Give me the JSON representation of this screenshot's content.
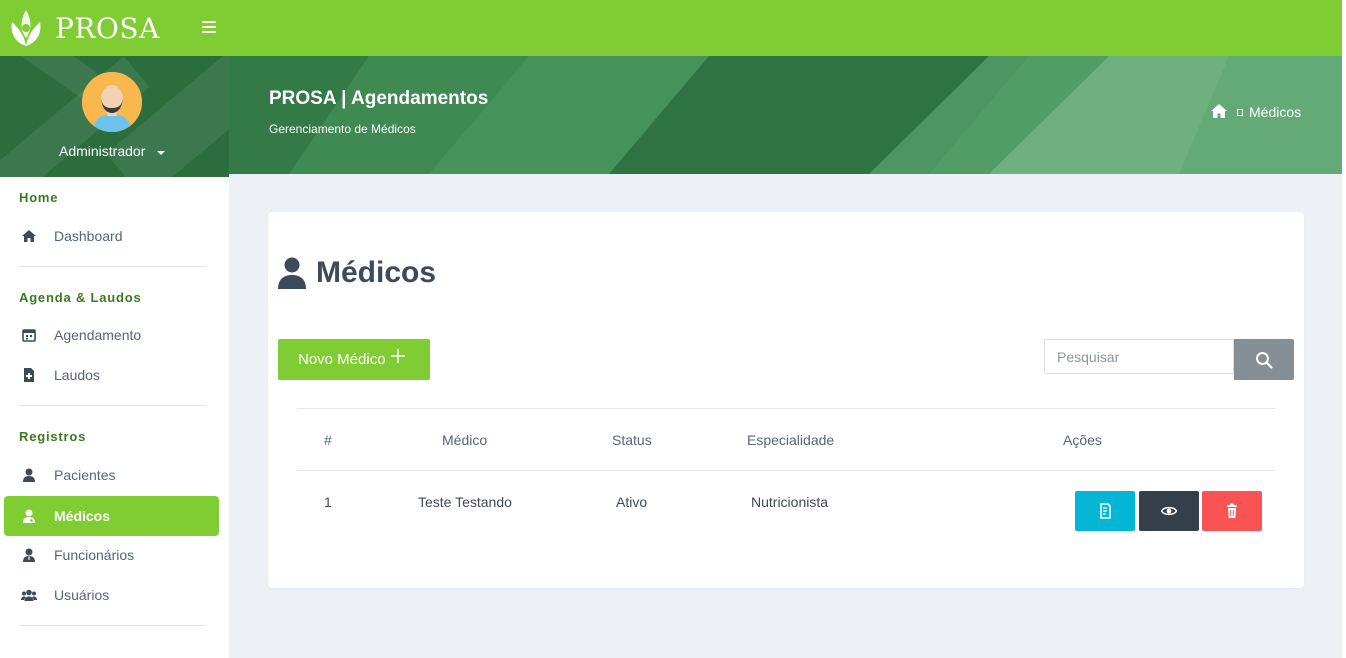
{
  "app": {
    "logo_text": "PROSA"
  },
  "colors": {
    "brand": "#7fcc33",
    "banner": "#3f8a52",
    "info": "#03b6d6",
    "dark": "#343f4a",
    "danger": "#fa5353"
  },
  "user": {
    "name": "Administrador",
    "icon": "avatar-icon"
  },
  "sidebar": {
    "sections": [
      {
        "caption": "Home",
        "items": [
          {
            "label": "Dashboard",
            "icon": "home-icon"
          }
        ]
      },
      {
        "caption": "Agenda & Laudos",
        "items": [
          {
            "label": "Agendamento",
            "icon": "calendar-icon"
          },
          {
            "label": "Laudos",
            "icon": "medical-file-icon"
          }
        ]
      },
      {
        "caption": "Registros",
        "items": [
          {
            "label": "Pacientes",
            "icon": "user-icon"
          },
          {
            "label": "Médicos",
            "icon": "doctor-icon",
            "active": true
          },
          {
            "label": "Funcionários",
            "icon": "employee-icon"
          },
          {
            "label": "Usuários",
            "icon": "users-icon"
          }
        ]
      }
    ]
  },
  "header": {
    "title": "PROSA | Agendamentos",
    "subtitle": "Gerenciamento de Médicos",
    "breadcrumb": {
      "current": "Médicos"
    }
  },
  "page": {
    "title": "Médicos",
    "new_button": "Novo Médico",
    "search_placeholder": "Pesquisar"
  },
  "table": {
    "columns": [
      "#",
      "Médico",
      "Status",
      "Especialidade",
      "Ações"
    ],
    "rows": [
      {
        "id": "1",
        "name": "Teste Testando",
        "status": "Ativo",
        "specialty": "Nutricionista"
      }
    ]
  }
}
